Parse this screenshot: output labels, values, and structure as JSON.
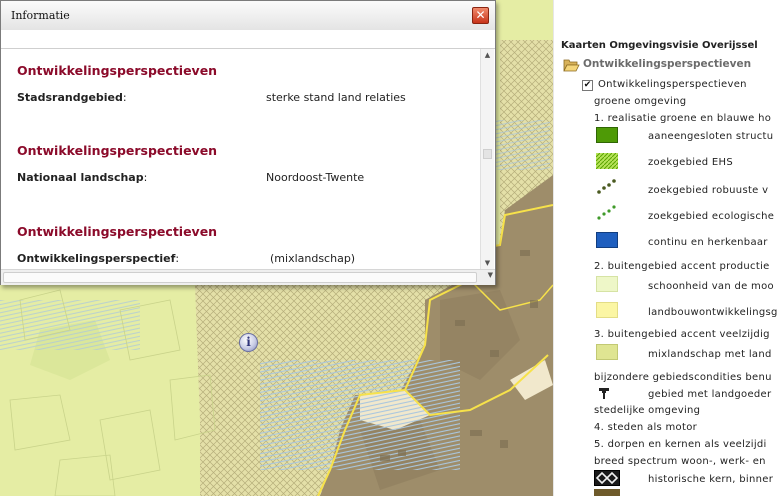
{
  "info_window": {
    "title": "Informatie",
    "close_symbol": "✕",
    "sections": [
      {
        "heading": "Ontwikkelingsperspectieven",
        "label": "Stadsrandgebied",
        "value": "sterke stand land relaties"
      },
      {
        "heading": "Ontwikkelingsperspectieven",
        "label": "Nationaal landschap",
        "value": "Noordoost-Twente"
      },
      {
        "heading": "Ontwikkelingsperspectieven",
        "label": "Ontwikkelingsperspectief",
        "value": "(mixlandschap)"
      }
    ],
    "colon": ":"
  },
  "map": {
    "info_marker_symbol": "i",
    "colors": {
      "rural": "#e5eda4",
      "urban": "#9e8d6a",
      "boundary": "#f7e24a"
    }
  },
  "legend": {
    "title": "Kaarten Omgevingsvisie Overijssel",
    "folder_label": "Ontwikkelingsperspectieven",
    "layer_label": "Ontwikkelingsperspectieven",
    "checked_symbol": "✔",
    "lines": [
      "groene omgeving",
      "1. realisatie groene en blauwe ho",
      "2. buitengebied accent productie",
      "3. buitengebied accent veelzijdig",
      "bijzondere gebiedscondities benu",
      "stedelijke omgeving",
      "4. steden als motor",
      "5. dorpen en kernen als veelzijdi",
      "breed spectrum woon-, werk- en"
    ],
    "items": [
      {
        "label": "aaneengesloten structu",
        "color": "#4e9a06",
        "icon": "solid-swatch"
      },
      {
        "label": "zoekgebied EHS",
        "color": "#9acd32",
        "icon": "hatched-swatch"
      },
      {
        "label": "zoekgebied robuuste v",
        "color": "#4a5a20",
        "icon": "dotted-line-swatch"
      },
      {
        "label": "zoekgebied ecologische",
        "color": "#3f9a2a",
        "icon": "dotted-line-swatch"
      },
      {
        "label": "continu en herkenbaar",
        "color": "#1f5fbf",
        "icon": "solid-swatch"
      },
      {
        "label": "schoonheid van de moo",
        "color": "#eef7c8",
        "icon": "solid-swatch"
      },
      {
        "label": "landbouwontwikkelingsg",
        "color": "#fbf6a4",
        "icon": "solid-swatch"
      },
      {
        "label": "mixlandschap met land",
        "color": "#dfe592",
        "icon": "solid-swatch"
      },
      {
        "label": "gebied met landgoeder",
        "color": "#222222",
        "icon": "estate-symbol"
      },
      {
        "label": "historische kern, binner",
        "color": "#333333",
        "icon": "historic-core-symbol"
      }
    ]
  }
}
